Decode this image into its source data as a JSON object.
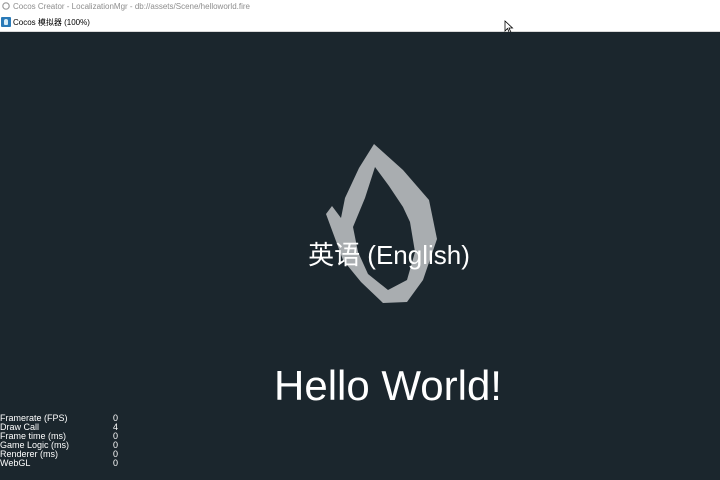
{
  "editor_window": {
    "title": "Cocos Creator - LocalizationMgr - db://assets/Scene/helloworld.fire"
  },
  "simulator_window": {
    "title": "Cocos 模拟器 (100%)"
  },
  "scene": {
    "language_label": "英语 (English)",
    "hello_label": "Hello World!"
  },
  "stats": [
    {
      "label": "Framerate (FPS)",
      "value": "0"
    },
    {
      "label": "Draw Call",
      "value": "4"
    },
    {
      "label": "Frame time (ms)",
      "value": "0"
    },
    {
      "label": "Game Logic (ms)",
      "value": "0"
    },
    {
      "label": "Renderer (ms)",
      "value": "0"
    },
    {
      "label": "WebGL",
      "value": "0"
    }
  ],
  "colors": {
    "canvas_background": "#1b262d",
    "logo_fill": "#a9adb0",
    "text": "#ffffff"
  },
  "icons": {
    "editor": "cocos-creator-icon",
    "simulator": "cocos-simulator-icon",
    "logo": "cocos-logo-icon",
    "cursor": "mouse-cursor-icon"
  }
}
